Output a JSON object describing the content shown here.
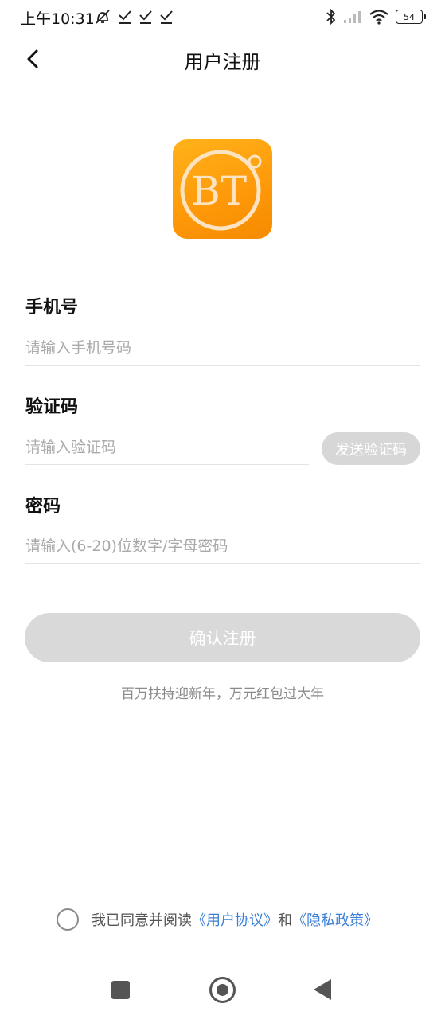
{
  "status_bar": {
    "time": "上午10:31",
    "battery": "54",
    "left_icons": [
      "alarm-off-icon",
      "check-icon",
      "check-icon",
      "check-icon"
    ],
    "right_icons": [
      "bluetooth-icon",
      "signal-icon",
      "wifi-icon",
      "battery-icon"
    ]
  },
  "header": {
    "title": "用户注册",
    "back_icon": "chevron-left-icon"
  },
  "logo": {
    "text": "BT",
    "colors": {
      "background": "#ff9f10",
      "ring": "#fde3c0"
    }
  },
  "form": {
    "phone": {
      "label": "手机号",
      "placeholder": "请输入手机号码",
      "value": ""
    },
    "code": {
      "label": "验证码",
      "placeholder": "请输入验证码",
      "value": "",
      "send_button": "发送验证码"
    },
    "password": {
      "label": "密码",
      "placeholder": "请输入(6-20)位数字/字母密码",
      "value": ""
    },
    "submit_label": "确认注册"
  },
  "promo": "百万扶持迎新年，万元红包过大年",
  "agreement": {
    "prefix": "我已同意并阅读",
    "user_agreement": "《用户协议》",
    "conjunction": "和",
    "privacy_policy": "《隐私政策》",
    "checked": false
  },
  "colors": {
    "link": "#3c7fd6",
    "disabled_button": "#d9d9d9"
  },
  "system_nav": [
    "recent-apps-icon",
    "home-icon",
    "back-triangle-icon"
  ]
}
